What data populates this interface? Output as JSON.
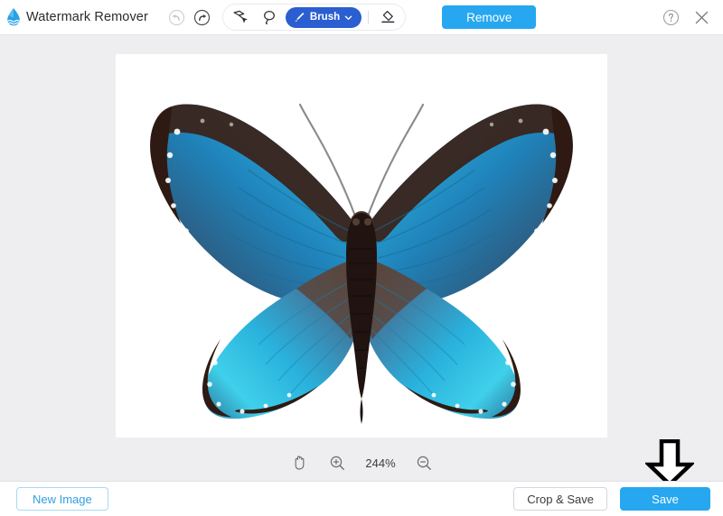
{
  "app": {
    "name": "Watermark Remover",
    "logo_icon": "water-drop-icon"
  },
  "toolbar": {
    "undo": {
      "icon": "undo-arrow-icon",
      "label": "Undo",
      "enabled": false
    },
    "redo": {
      "icon": "redo-arrow-icon",
      "label": "Redo",
      "enabled": true
    },
    "polygon_lasso": {
      "icon": "polygon-lasso-icon",
      "label": "Polygonal Lasso"
    },
    "free_lasso": {
      "icon": "lasso-icon",
      "label": "Lasso"
    },
    "brush": {
      "icon": "brush-icon",
      "label": "Brush",
      "chevron": "chevron-down-icon"
    },
    "eraser": {
      "icon": "eraser-icon",
      "label": "Eraser"
    },
    "remove_label": "Remove",
    "help": {
      "icon": "question-mark-icon",
      "label": "Help"
    },
    "close": {
      "icon": "close-icon",
      "label": "Close"
    }
  },
  "canvas": {
    "image_alt": "Blue morpho butterfly with spread wings on white background",
    "colors": {
      "wing_blue": "#2fb6e0",
      "wing_deep_blue": "#1a6fa8",
      "wing_dark": "#3a2119",
      "body_dark": "#2b1b14",
      "background": "#ffffff"
    }
  },
  "zoom_controls": {
    "hand_tool": {
      "icon": "hand-icon",
      "label": "Hand Tool"
    },
    "zoom_in": {
      "icon": "zoom-in-icon",
      "label": "Zoom In"
    },
    "level": "244%",
    "zoom_out": {
      "icon": "zoom-out-icon",
      "label": "Zoom Out"
    }
  },
  "annotation": {
    "arrow": {
      "icon": "down-arrow-icon",
      "points_to": "save-button"
    }
  },
  "footer": {
    "new_image_label": "New Image",
    "crop_save_label": "Crop & Save",
    "save_label": "Save"
  },
  "theme": {
    "accent_blue": "#26a7f0",
    "brush_blue": "#2a5ed1",
    "outline_blue": "#aad9f2",
    "stage_grey": "#eeeef0",
    "bar_white": "#ffffff"
  }
}
